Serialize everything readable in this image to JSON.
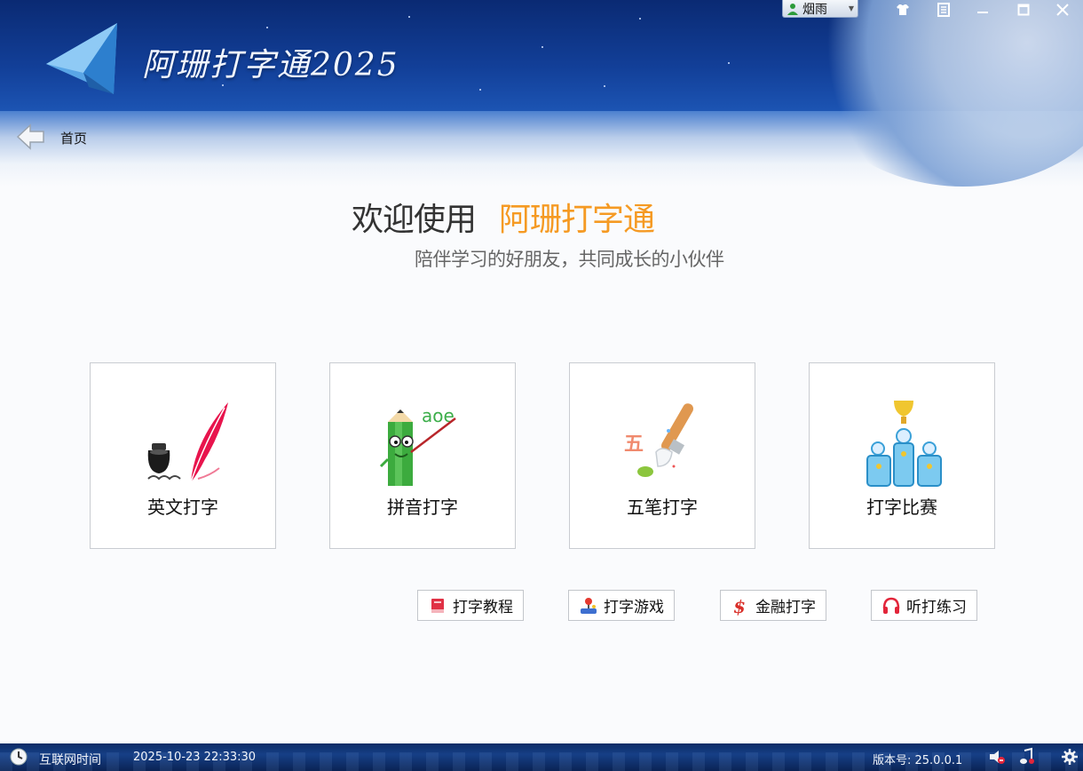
{
  "window": {
    "app_title": "阿珊打字通2025",
    "user_name": "烟雨"
  },
  "nav": {
    "breadcrumb": "首页"
  },
  "welcome": {
    "prefix": "欢迎使用",
    "brand": "阿珊打字通",
    "tagline": "陪伴学习的好朋友，共同成长的小伙伴"
  },
  "cards": [
    {
      "label": "英文打字",
      "icon": "quill-ink-icon"
    },
    {
      "label": "拼音打字",
      "icon": "pencil-teacher-icon",
      "art_text": "aoe"
    },
    {
      "label": "五笔打字",
      "icon": "paint-brush-icon",
      "art_text": "五"
    },
    {
      "label": "打字比赛",
      "icon": "trophy-podium-icon"
    }
  ],
  "tools": [
    {
      "label": "打字教程",
      "icon": "book-icon"
    },
    {
      "label": "打字游戏",
      "icon": "joystick-icon"
    },
    {
      "label": "金融打字",
      "icon": "dollar-icon"
    },
    {
      "label": "听打练习",
      "icon": "headphones-icon"
    }
  ],
  "status": {
    "time_label": "互联网时间",
    "datetime": "2025-10-23 22:33:30",
    "version": "版本号: 25.0.0.1"
  },
  "colors": {
    "brand_orange": "#f59a23",
    "header_blue": "#123f98"
  }
}
